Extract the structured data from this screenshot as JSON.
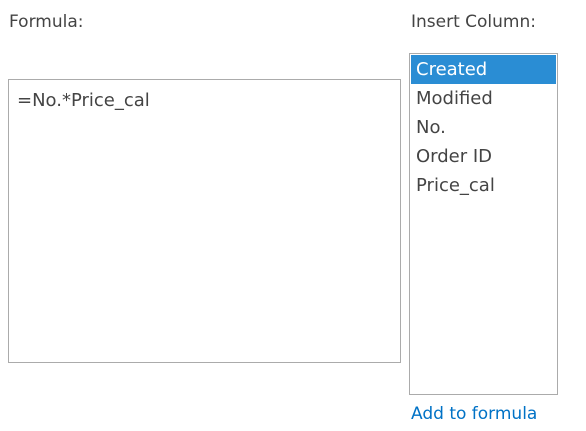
{
  "formula": {
    "label": "Formula:",
    "value": "=No.*Price_cal"
  },
  "insert_column": {
    "label": "Insert Column:",
    "items": [
      {
        "label": "Created",
        "selected": true
      },
      {
        "label": "Modified",
        "selected": false
      },
      {
        "label": "No.",
        "selected": false
      },
      {
        "label": "Order ID",
        "selected": false
      },
      {
        "label": "Price_cal",
        "selected": false
      }
    ],
    "add_link": "Add to formula"
  },
  "colors": {
    "text": "#444444",
    "selection": "#2a8dd4",
    "link": "#0072c6",
    "border": "#ababab"
  }
}
